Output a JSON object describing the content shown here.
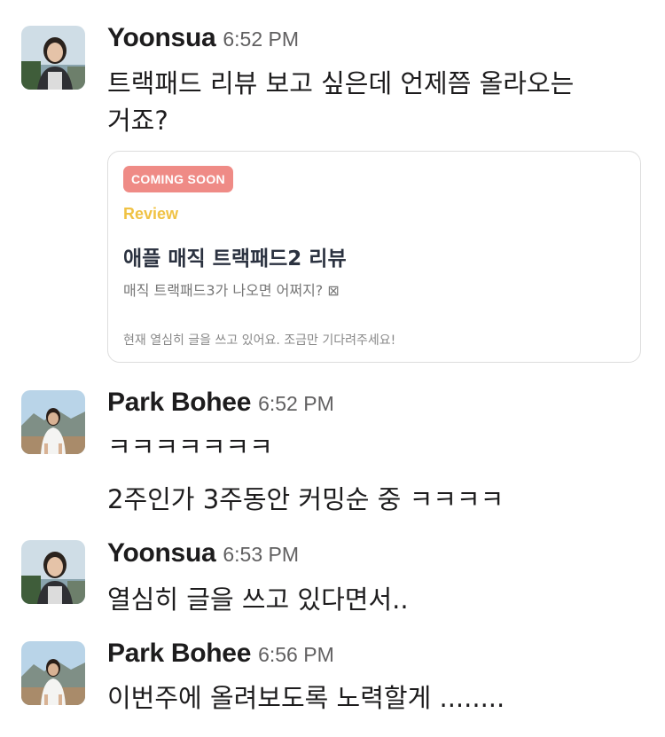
{
  "messages": [
    {
      "sender": "Yoonsua",
      "time": "6:52 PM",
      "lines": [
        "트랙패드 리뷰 보고 싶은데 언제쯤 올라오는",
        "거죠?"
      ]
    },
    {
      "sender": "Park Bohee",
      "time": "6:52 PM",
      "lines": [
        "ㅋㅋㅋㅋㅋㅋㅋ",
        "2주인가 3주동안 커밍순 중 ㅋㅋㅋㅋ"
      ]
    },
    {
      "sender": "Yoonsua",
      "time": "6:53 PM",
      "lines": [
        "열심히 글을 쓰고 있다면서.."
      ]
    },
    {
      "sender": "Park Bohee",
      "time": "6:56 PM",
      "lines": [
        "이번주에 올려보도록 노력할게 ........"
      ]
    }
  ],
  "link_card": {
    "badge": "COMING SOON",
    "category": "Review",
    "title": "애플 매직 트랙패드2 리뷰",
    "subtitle": "매직 트랙패드3가 나오면 어쩌지? ⊠",
    "footer": "현재 열심히 글을 쓰고 있어요. 조금만 기다려주세요!",
    "badge_color": "#ef8b86",
    "category_color": "#f0c244"
  },
  "avatars": {
    "yoonsua": "avatar-photo-woman-seaside",
    "park_bohee": "avatar-photo-woman-mountains"
  }
}
